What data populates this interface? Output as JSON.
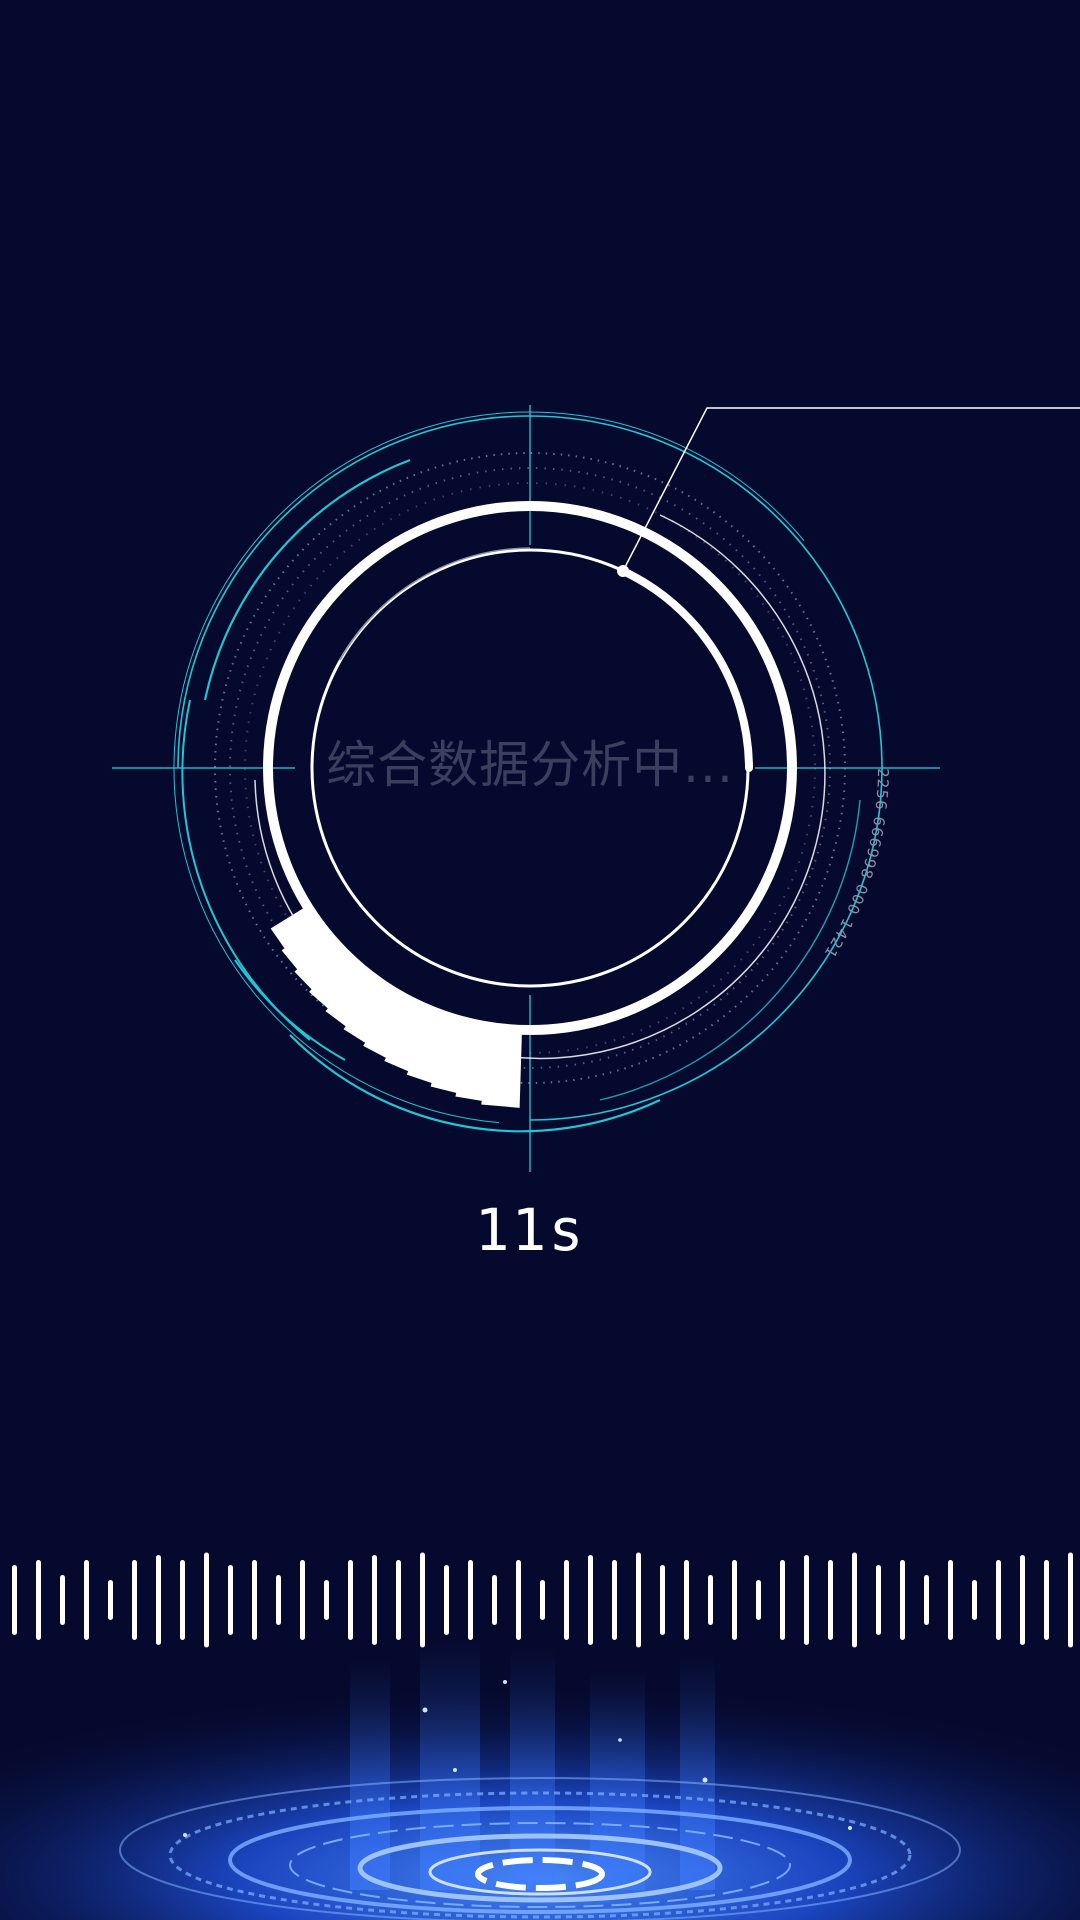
{
  "status_text": "综合数据分析中...",
  "countdown": "11s",
  "code_readout": "2256 666998 000 1421",
  "icons": {
    "scanner": "circular-scanner-icon",
    "wave": "audio-wave-icon",
    "platform": "hologram-platform-icon"
  },
  "colors": {
    "background": "#05092d",
    "accent": "#1fc6d6",
    "ring": "#ffffff",
    "muted_text": "#3b3e5c",
    "platform_glow": "#1e4fd8"
  }
}
